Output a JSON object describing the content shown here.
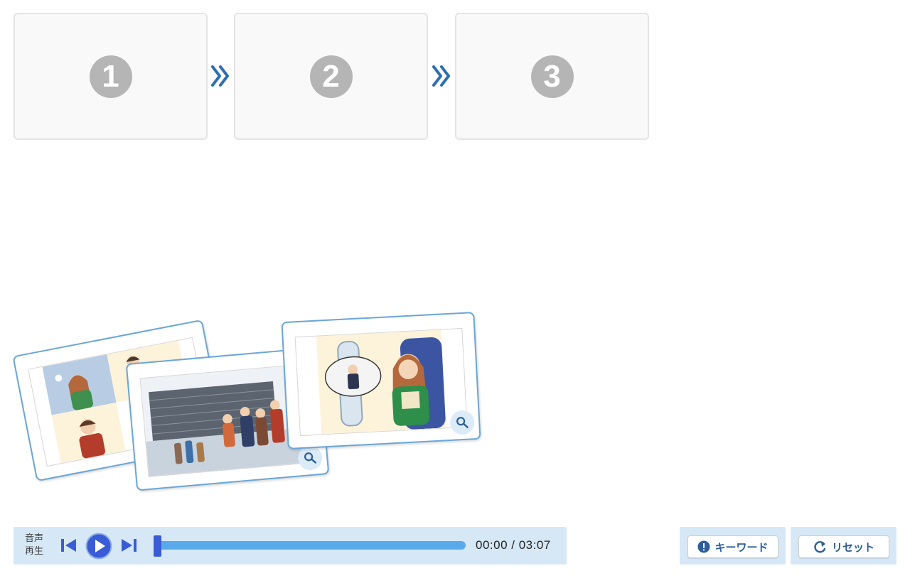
{
  "slots": [
    {
      "number": "1"
    },
    {
      "number": "2"
    },
    {
      "number": "3"
    }
  ],
  "cards": [
    {
      "id": "card-snow-call",
      "icon": "zoom-icon"
    },
    {
      "id": "card-airport",
      "icon": "zoom-icon"
    },
    {
      "id": "card-airplane",
      "icon": "zoom-icon"
    }
  ],
  "player": {
    "label_line1": "音声",
    "label_line2": "再生",
    "time": "00:00 / 03:07",
    "progress": 0
  },
  "buttons": {
    "keyword": "キーワード",
    "reset": "リセット"
  },
  "colors": {
    "accent": "#2d6fb0",
    "player_bg": "#d6e8f6",
    "track": "#5aa9ea",
    "thumb": "#3a5bd6"
  }
}
